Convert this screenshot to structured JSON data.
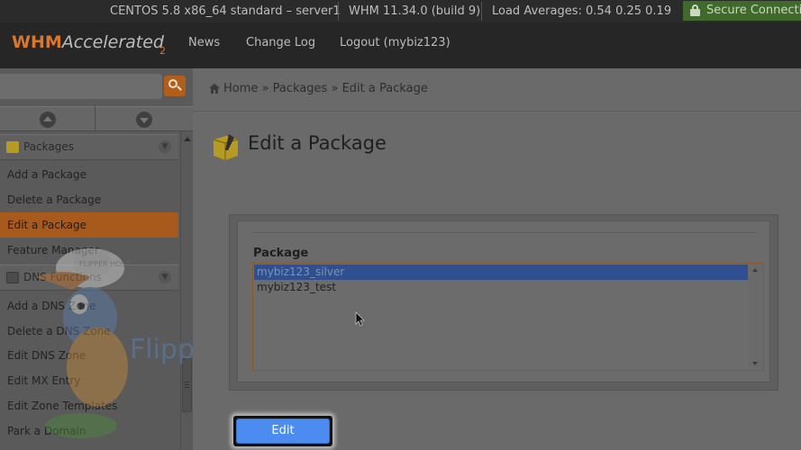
{
  "status_bar": {
    "os": "CENTOS 5.8 x86_64 standard – server1",
    "version": "WHM 11.34.0 (build 9)",
    "load": "Load Averages: 0.54 0.25 0.19",
    "secure": "Secure Connection"
  },
  "header": {
    "logo_main": "WHM",
    "logo_accel": "Accelerated",
    "logo_sup": "2",
    "nav": [
      "News",
      "Change Log",
      "Logout (mybiz123)"
    ]
  },
  "sidebar": {
    "search_placeholder": "",
    "sections": [
      {
        "title": "Packages",
        "items": [
          "Add a Package",
          "Delete a Package",
          "Edit a Package",
          "Feature Manager"
        ],
        "active_item": "Edit a Package"
      },
      {
        "title": "DNS Functions",
        "items": [
          "Add a DNS Zone",
          "Delete a DNS Zone",
          "Edit DNS Zone",
          "Edit MX Entry",
          "Edit Zone Templates",
          "Park a Domain"
        ]
      }
    ]
  },
  "watermark": {
    "text": "FlipperHost",
    "cap_text": "FLIPPER HOST"
  },
  "main": {
    "breadcrumb": [
      "Home",
      "Packages",
      "Edit a Package"
    ],
    "breadcrumb_sep": "»",
    "title": "Edit a Package",
    "package_label": "Package",
    "packages": [
      "mybiz123_silver",
      "mybiz123_test"
    ],
    "selected_package": "mybiz123_silver",
    "edit_button": "Edit"
  },
  "colors": {
    "accent": "#d8782c",
    "active_item": "#a8591c",
    "selected_option": "#2f4f8f",
    "edit_button": "#4c8bf0",
    "secure_bg": "#3f6a2b"
  }
}
